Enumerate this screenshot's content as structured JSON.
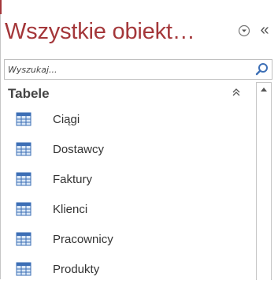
{
  "header": {
    "title": "Wszystkie obiekt…",
    "menu_icon": "circle-chevron-down-icon",
    "collapse_label": "«"
  },
  "search": {
    "placeholder": "Wyszukaj...",
    "value": "",
    "icon": "search-icon"
  },
  "group": {
    "title": "Tabele",
    "chevron_icon": "double-chevron-up-icon"
  },
  "items": [
    {
      "label": "Ciągi",
      "icon": "table-icon"
    },
    {
      "label": "Dostawcy",
      "icon": "table-icon"
    },
    {
      "label": "Faktury",
      "icon": "table-icon"
    },
    {
      "label": "Klienci",
      "icon": "table-icon"
    },
    {
      "label": "Pracownicy",
      "icon": "table-icon"
    },
    {
      "label": "Produkty",
      "icon": "table-icon"
    }
  ],
  "colors": {
    "accent": "#a4373a",
    "text": "#333333",
    "border": "#c6c6c6",
    "table_icon_blue": "#3d6fb6"
  }
}
